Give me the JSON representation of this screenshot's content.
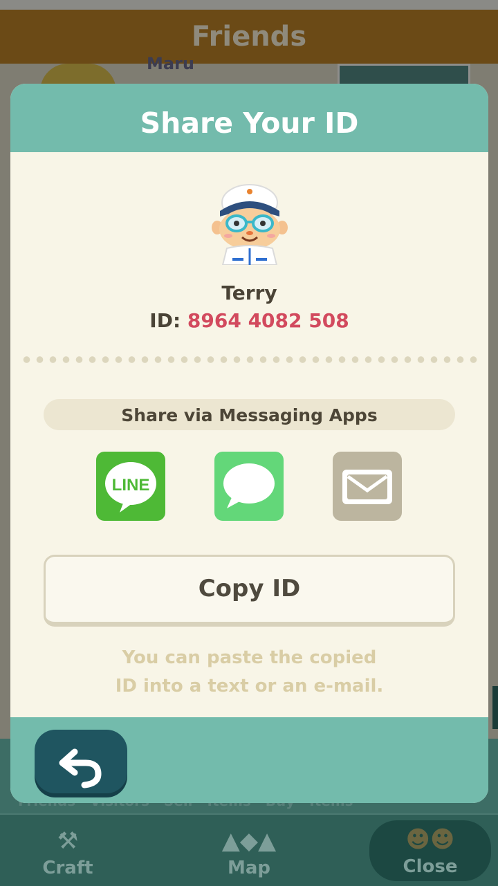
{
  "background": {
    "header_title": "Friends",
    "friend_name": "Maru",
    "subtabs": "Friends Visitors Sell Items Buy Items",
    "nav": [
      {
        "label": "Craft",
        "icon": "hammer-icon"
      },
      {
        "label": "Map",
        "icon": "map-icon"
      },
      {
        "label": "Close",
        "icon": "villagers-icon"
      }
    ]
  },
  "modal": {
    "title": "Share Your ID",
    "user": {
      "name": "Terry",
      "id_label": "ID:",
      "id_value": "8964 4082 508"
    },
    "share_label": "Share via Messaging Apps",
    "share_apps": [
      {
        "name": "LINE",
        "text": "LINE",
        "color": "#4eb936"
      },
      {
        "name": "Messages",
        "color": "#63d779"
      },
      {
        "name": "Mail",
        "color": "#bcb59f"
      }
    ],
    "copy_button": "Copy ID",
    "hint": [
      "You can paste the copied",
      "ID into a text or an e-mail."
    ]
  },
  "colors": {
    "teal": "#73bbac",
    "cream": "#f8f5e7",
    "id_red": "#d24a5e",
    "back_button": "#1f5560"
  }
}
